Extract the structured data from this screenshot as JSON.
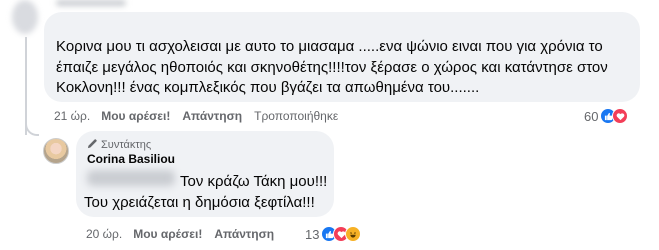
{
  "comment": {
    "lines": [
      "Κορινα μου τι ασχολεισαι με αυτο το μιασαμα .....ενα ψώνιο ειναι που για χρόνια το",
      "έπαιζε μεγάλος ηθοποιός και σκηνοθέτης!!!!τον ξέρασε ο χώρος και κατάντησε στον",
      "Κοκλονη!!! ένας κομπλεξικός που βγάζει τα απωθημένα του......."
    ],
    "time": "21 ώρ.",
    "like_label": "Μου αρέσει!",
    "reply_label": "Απάντηση",
    "edited_label": "Τροποποιήθηκε",
    "reaction_count": "60",
    "reactions": [
      "like-icon",
      "love-icon"
    ]
  },
  "reply": {
    "author_badge": "Συντάκτης",
    "author_name": "Corina Basiliou",
    "lines": [
      "Τον κράζω Τάκη μου!!!",
      "Του χρειάζεται η δημόσια ξεφτίλα!!!"
    ],
    "time": "20 ώρ.",
    "like_label": "Μου αρέσει!",
    "reply_label": "Απάντηση",
    "reaction_count": "13",
    "reactions": [
      "like-icon",
      "love-icon",
      "haha-icon"
    ]
  },
  "colors": {
    "bubble": "#f0f2f5",
    "meta_text": "#65676b",
    "like": "#1877f2",
    "love": "#f33e58",
    "haha": "#f7b125"
  }
}
